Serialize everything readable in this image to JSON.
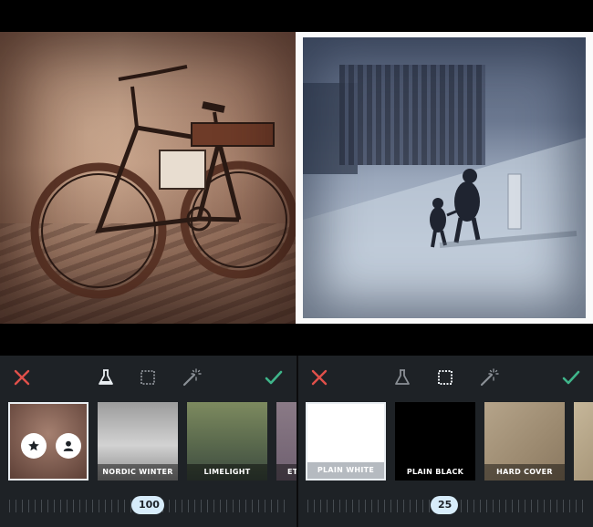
{
  "left_panel": {
    "filters": [
      {
        "label": ""
      },
      {
        "label": "NORDIC WINTER"
      },
      {
        "label": "LIMELIGHT"
      },
      {
        "label": "ET"
      }
    ],
    "slider_value": "100",
    "active_tool": "filters"
  },
  "right_panel": {
    "frames": [
      {
        "label": "PLAIN WHITE"
      },
      {
        "label": "PLAIN BLACK"
      },
      {
        "label": "HARD COVER"
      },
      {
        "label": ""
      }
    ],
    "slider_value": "25",
    "active_tool": "frames"
  },
  "colors": {
    "cancel": "#e0504a",
    "confirm": "#3fb58a",
    "toolbar_icon": "#8b9096",
    "toolbar_icon_active": "#e9eef2",
    "slider_pill": "#d7ecfa"
  },
  "icons": [
    "close-icon",
    "flask-icon",
    "frame-icon",
    "magic-wand-icon",
    "check-icon",
    "star-icon",
    "person-icon"
  ]
}
